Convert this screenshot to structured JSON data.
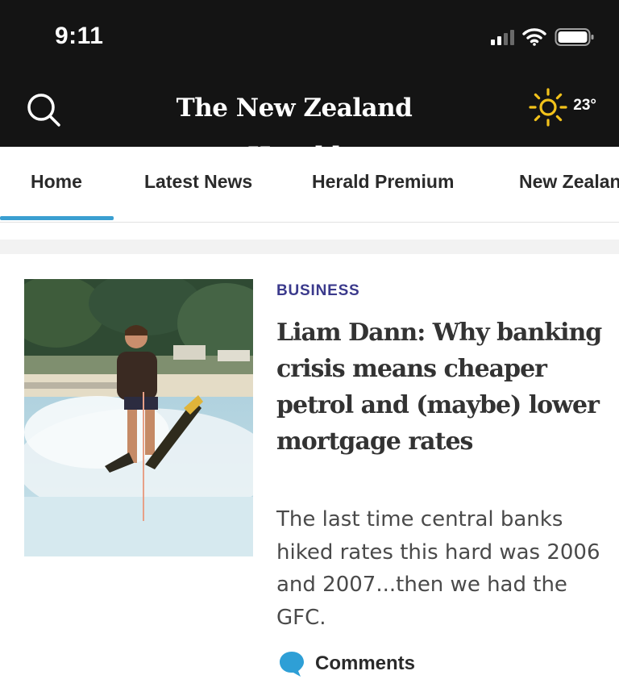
{
  "status_bar": {
    "time": "9:11"
  },
  "header": {
    "masthead": "The New Zealand Herald",
    "weather": {
      "icon": "sun-icon",
      "temperature": "23°"
    }
  },
  "nav": {
    "tabs": [
      {
        "label": "Home",
        "active": true
      },
      {
        "label": "Latest News",
        "active": false
      },
      {
        "label": "Herald Premium",
        "active": false
      },
      {
        "label": "New Zealand",
        "active": false
      }
    ],
    "accent_color": "#3a9fd1"
  },
  "article": {
    "section": "BUSINESS",
    "section_color": "#3b3a8c",
    "headline": "Liam Dann: Why banking crisis means cheaper petrol and (maybe) lower mortgage rates",
    "summary": "The last time central banks hiked rates this hard was 2006 and 2007...then we had the GFC.",
    "comments_label": "Comments",
    "comments_icon": "speech-bubble-icon"
  }
}
